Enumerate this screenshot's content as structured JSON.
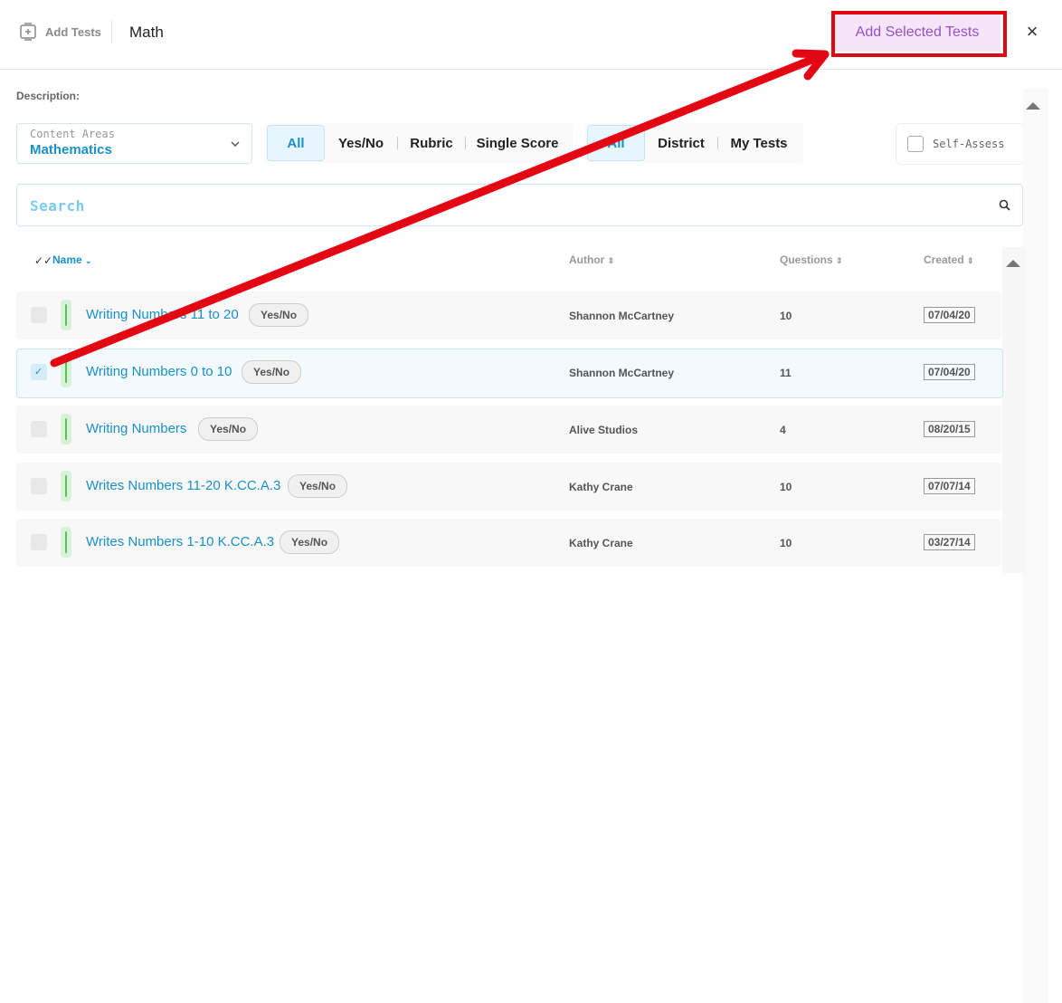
{
  "header": {
    "add_tests_label": "Add Tests",
    "title": "Math",
    "add_selected_label": "Add Selected Tests",
    "close_label": "×"
  },
  "description_label": "Description:",
  "content_areas": {
    "label": "Content Areas",
    "value": "Mathematics"
  },
  "type_filter": {
    "items": [
      "All",
      "Yes/No",
      "Rubric",
      "Single Score"
    ],
    "active": "All"
  },
  "source_filter": {
    "items": [
      "All",
      "District",
      "My Tests"
    ],
    "active": "All"
  },
  "self_assess": {
    "label": "Self-Assess",
    "checked": false
  },
  "search": {
    "placeholder": "Search"
  },
  "table": {
    "columns": {
      "name": "Name",
      "author": "Author",
      "questions": "Questions",
      "created": "Created"
    },
    "rows": [
      {
        "name": "Writing Numbers 11 to 20",
        "type": "Yes/No",
        "author": "Shannon McCartney",
        "questions": "10",
        "created": "07/04/20",
        "selected": false
      },
      {
        "name": "Writing Numbers 0 to 10",
        "type": "Yes/No",
        "author": "Shannon McCartney",
        "questions": "11",
        "created": "07/04/20",
        "selected": true
      },
      {
        "name": "Writing Numbers",
        "type": "Yes/No",
        "author": "Alive Studios",
        "questions": "4",
        "created": "08/20/15",
        "selected": false
      },
      {
        "name": "Writes Numbers 11-20 K.CC.A.3",
        "type": "Yes/No",
        "author": "Kathy Crane",
        "questions": "10",
        "created": "07/07/14",
        "selected": false
      },
      {
        "name": "Writes Numbers 1-10 K.CC.A.3",
        "type": "Yes/No",
        "author": "Kathy Crane",
        "questions": "10",
        "created": "03/27/14",
        "selected": false
      }
    ]
  },
  "colors": {
    "accent": "#1a90c8",
    "primary_button_text": "#9a4fc4",
    "annotation": "#e30613"
  }
}
